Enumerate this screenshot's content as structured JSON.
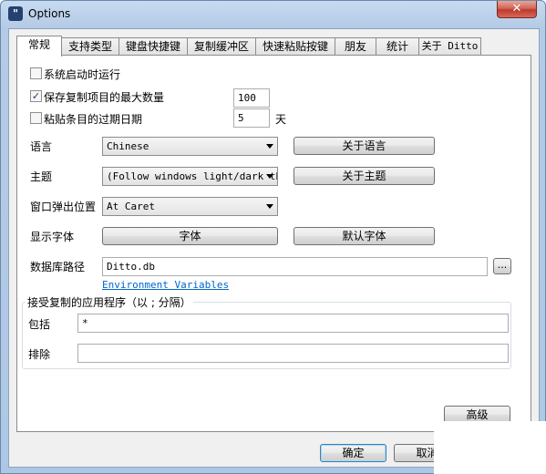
{
  "window": {
    "title": "Options",
    "icon_glyph": "\"",
    "close_glyph": "✕"
  },
  "tabs": [
    {
      "label": "常规",
      "active": true
    },
    {
      "label": "支持类型"
    },
    {
      "label": "键盘快捷键"
    },
    {
      "label": "复制缓冲区"
    },
    {
      "label": "快速粘贴按键"
    },
    {
      "label": "朋友"
    },
    {
      "label": "统计"
    },
    {
      "label": "关于 Ditto"
    }
  ],
  "general": {
    "start_on_startup": {
      "label": "系统启动时运行",
      "checked": false
    },
    "max_copies": {
      "label": "保存复制项目的最大数量",
      "checked": true,
      "value": "100"
    },
    "expire": {
      "label": "粘贴条目的过期日期",
      "checked": false,
      "value": "5",
      "unit": "天"
    },
    "language": {
      "label": "语言",
      "value": "Chinese",
      "button": "关于语言"
    },
    "theme": {
      "label": "主题",
      "value": "(Follow windows light/dark th",
      "button": "关于主题"
    },
    "popup_position": {
      "label": "窗口弹出位置",
      "value": "At Caret"
    },
    "display_font": {
      "label": "显示字体",
      "font_button": "字体",
      "default_button": "默认字体"
    },
    "db_path": {
      "label": "数据库路径",
      "value": "Ditto.db",
      "browse": "...",
      "env_link": "Environment Variables"
    },
    "accepted_apps": {
      "title": "接受复制的应用程序（以 ; 分隔）",
      "include_label": "包括",
      "include_value": "*",
      "exclude_label": "排除",
      "exclude_value": ""
    },
    "advanced_button": "高级"
  },
  "footer": {
    "ok": "确定",
    "cancel": "取消"
  }
}
